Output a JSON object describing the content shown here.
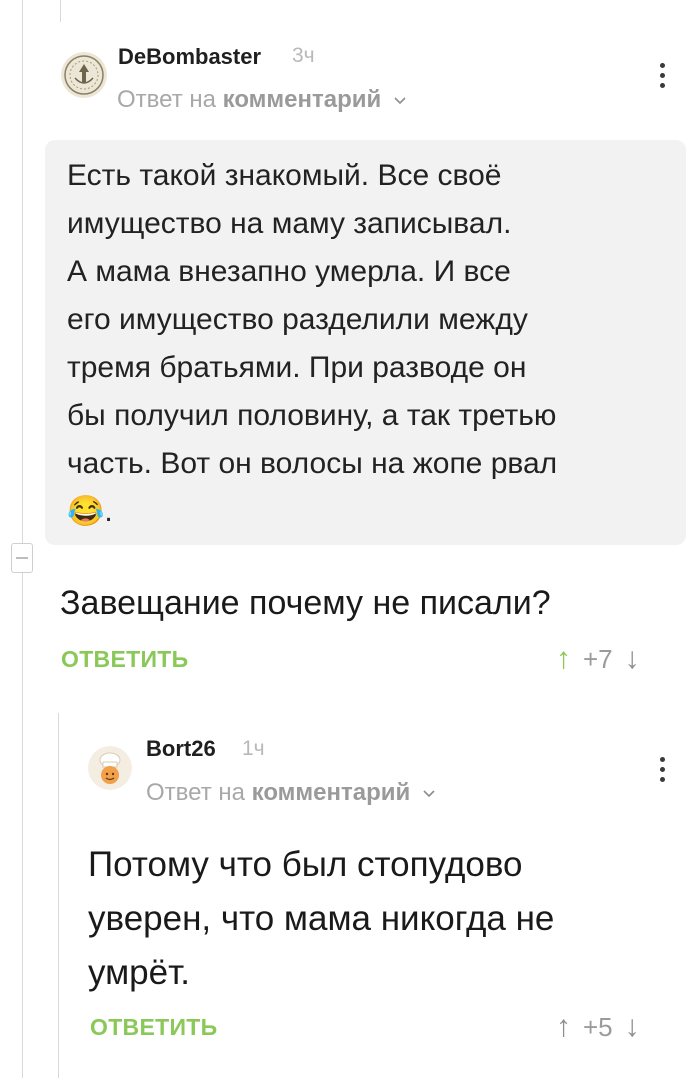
{
  "comment1": {
    "username": "DeBombaster",
    "time": "3ч",
    "reply_prefix": "Ответ на",
    "reply_target": "комментарий",
    "quoted_text": "Есть такой знакомый. Все своё\nимущество на маму записывал.\nА мама внезапно умерла. И все\nего имущество разделили между\nтремя братьями. При разводе он\nбы получил половину, а так третью\nчасть. Вот он волосы на жопе рвал\n😂.",
    "text": "Завещание почему не писали?",
    "reply_label": "ОТВЕТИТЬ",
    "rating": "+7"
  },
  "comment2": {
    "username": "Bort26",
    "time": "1ч",
    "reply_prefix": "Ответ на",
    "reply_target": "комментарий",
    "text": "Потому что был стопудово\nуверен, что мама никогда не\nумрёт.",
    "reply_label": "ОТВЕТИТЬ",
    "rating": "+5"
  },
  "colors": {
    "accent_green": "#8ac858",
    "quote_bg": "#f2f2f2",
    "thread_line": "#d9d9d9"
  },
  "icons": [
    "collapse-icon",
    "more-options-icon",
    "chevron-down-icon",
    "arrow-up-icon",
    "arrow-down-icon"
  ]
}
